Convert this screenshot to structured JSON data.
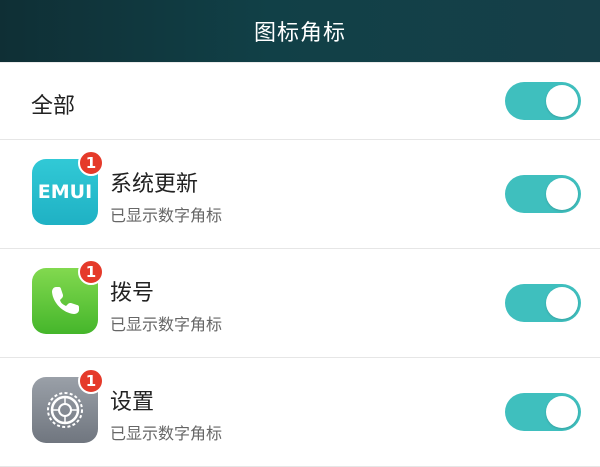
{
  "header": {
    "title": "图标角标"
  },
  "all_row": {
    "label": "全部",
    "toggle_on": true
  },
  "apps": [
    {
      "name": "系统更新",
      "subtitle": "已显示数字角标",
      "badge": "1",
      "icon_text": "EMUI",
      "icon": "emui-icon",
      "toggle_on": true
    },
    {
      "name": "拨号",
      "subtitle": "已显示数字角标",
      "badge": "1",
      "icon": "phone-icon",
      "toggle_on": true
    },
    {
      "name": "设置",
      "subtitle": "已显示数字角标",
      "badge": "1",
      "icon": "settings-gear-icon",
      "toggle_on": true
    }
  ],
  "colors": {
    "accent": "#3fbfbe",
    "badge": "#e53a2a",
    "header": "#114047"
  }
}
